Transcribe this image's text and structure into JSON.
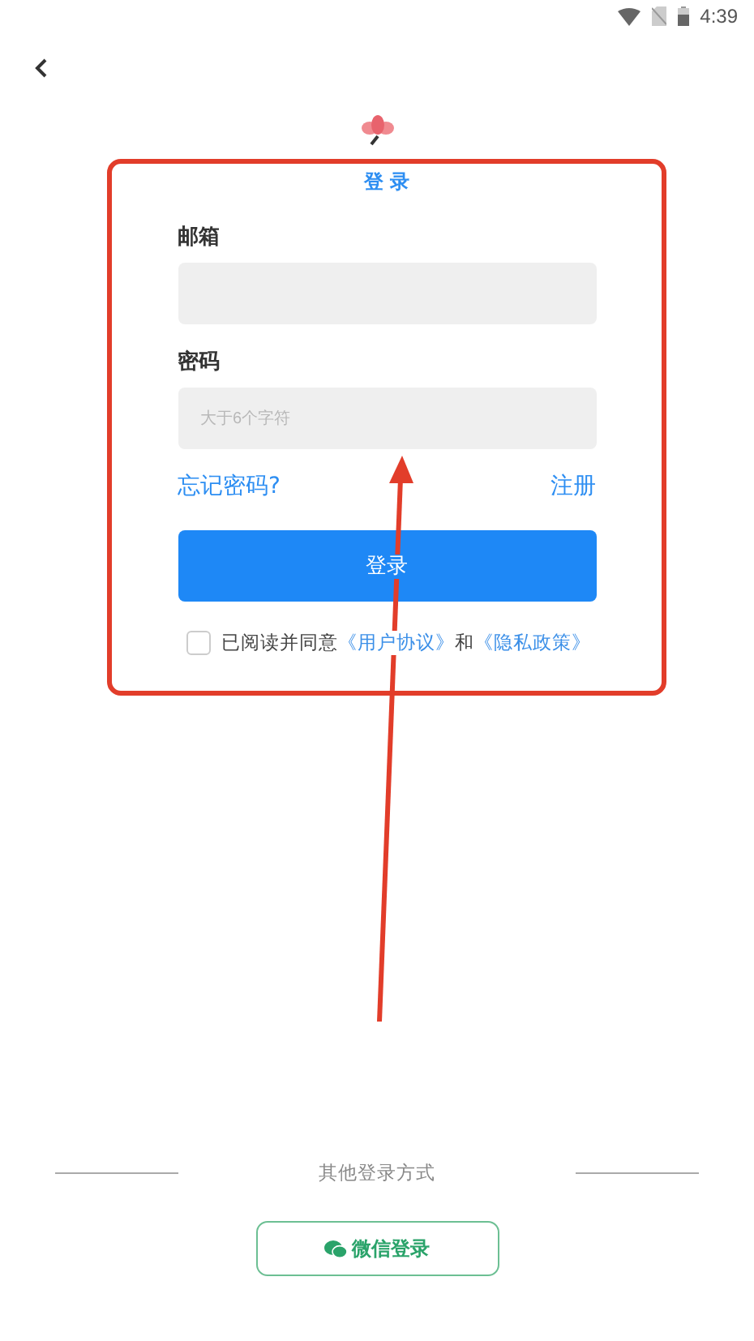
{
  "status_bar": {
    "time": "4:39"
  },
  "login_card": {
    "title": "登 录",
    "fields": [
      {
        "label": "邮箱"
      },
      {
        "label": "密码",
        "placeholder": "大于6个字符"
      }
    ],
    "forgot_link": "忘记密码?",
    "register_link": "注册",
    "submit_button": "登录",
    "agreement": {
      "checked": false,
      "text": "已阅读并同意",
      "link_1": "《用户协议》",
      "joiner": "和",
      "link_2": "《隐私政策》"
    }
  },
  "other_login": {
    "label": "其他登录方式",
    "wechat_button": "微信登录"
  },
  "annotations": {
    "highlight_frame": true,
    "arrow": true
  }
}
